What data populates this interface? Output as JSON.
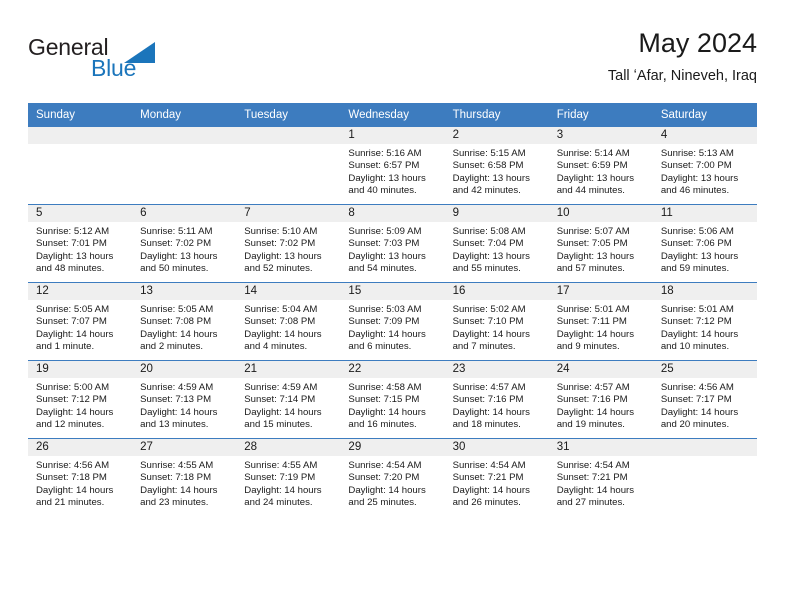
{
  "logo": {
    "word_one": "General",
    "word_two": "Blue",
    "triangle_color": "#1b75bb",
    "icon": "general-blue-logo"
  },
  "header": {
    "title": "May 2024",
    "subtitle": "Tall ʻAfar, Nineveh, Iraq"
  },
  "theme": {
    "header_blue": "#3d7cbf",
    "daynum_band": "#efefef",
    "text": "#1a1a1a",
    "logo_blue": "#1b75bb"
  },
  "weekdays": [
    "Sunday",
    "Monday",
    "Tuesday",
    "Wednesday",
    "Thursday",
    "Friday",
    "Saturday"
  ],
  "labels": {
    "sunrise_prefix": "Sunrise:",
    "sunset_prefix": "Sunset:",
    "daylight_prefix": "Daylight:"
  },
  "weeks": [
    [
      {
        "day": "",
        "sunrise": "",
        "sunset": "",
        "daylight_line1": "",
        "daylight_line2": ""
      },
      {
        "day": "",
        "sunrise": "",
        "sunset": "",
        "daylight_line1": "",
        "daylight_line2": ""
      },
      {
        "day": "",
        "sunrise": "",
        "sunset": "",
        "daylight_line1": "",
        "daylight_line2": ""
      },
      {
        "day": "1",
        "sunrise": "Sunrise: 5:16 AM",
        "sunset": "Sunset: 6:57 PM",
        "daylight_line1": "Daylight: 13 hours",
        "daylight_line2": "and 40 minutes."
      },
      {
        "day": "2",
        "sunrise": "Sunrise: 5:15 AM",
        "sunset": "Sunset: 6:58 PM",
        "daylight_line1": "Daylight: 13 hours",
        "daylight_line2": "and 42 minutes."
      },
      {
        "day": "3",
        "sunrise": "Sunrise: 5:14 AM",
        "sunset": "Sunset: 6:59 PM",
        "daylight_line1": "Daylight: 13 hours",
        "daylight_line2": "and 44 minutes."
      },
      {
        "day": "4",
        "sunrise": "Sunrise: 5:13 AM",
        "sunset": "Sunset: 7:00 PM",
        "daylight_line1": "Daylight: 13 hours",
        "daylight_line2": "and 46 minutes."
      }
    ],
    [
      {
        "day": "5",
        "sunrise": "Sunrise: 5:12 AM",
        "sunset": "Sunset: 7:01 PM",
        "daylight_line1": "Daylight: 13 hours",
        "daylight_line2": "and 48 minutes."
      },
      {
        "day": "6",
        "sunrise": "Sunrise: 5:11 AM",
        "sunset": "Sunset: 7:02 PM",
        "daylight_line1": "Daylight: 13 hours",
        "daylight_line2": "and 50 minutes."
      },
      {
        "day": "7",
        "sunrise": "Sunrise: 5:10 AM",
        "sunset": "Sunset: 7:02 PM",
        "daylight_line1": "Daylight: 13 hours",
        "daylight_line2": "and 52 minutes."
      },
      {
        "day": "8",
        "sunrise": "Sunrise: 5:09 AM",
        "sunset": "Sunset: 7:03 PM",
        "daylight_line1": "Daylight: 13 hours",
        "daylight_line2": "and 54 minutes."
      },
      {
        "day": "9",
        "sunrise": "Sunrise: 5:08 AM",
        "sunset": "Sunset: 7:04 PM",
        "daylight_line1": "Daylight: 13 hours",
        "daylight_line2": "and 55 minutes."
      },
      {
        "day": "10",
        "sunrise": "Sunrise: 5:07 AM",
        "sunset": "Sunset: 7:05 PM",
        "daylight_line1": "Daylight: 13 hours",
        "daylight_line2": "and 57 minutes."
      },
      {
        "day": "11",
        "sunrise": "Sunrise: 5:06 AM",
        "sunset": "Sunset: 7:06 PM",
        "daylight_line1": "Daylight: 13 hours",
        "daylight_line2": "and 59 minutes."
      }
    ],
    [
      {
        "day": "12",
        "sunrise": "Sunrise: 5:05 AM",
        "sunset": "Sunset: 7:07 PM",
        "daylight_line1": "Daylight: 14 hours",
        "daylight_line2": "and 1 minute."
      },
      {
        "day": "13",
        "sunrise": "Sunrise: 5:05 AM",
        "sunset": "Sunset: 7:08 PM",
        "daylight_line1": "Daylight: 14 hours",
        "daylight_line2": "and 2 minutes."
      },
      {
        "day": "14",
        "sunrise": "Sunrise: 5:04 AM",
        "sunset": "Sunset: 7:08 PM",
        "daylight_line1": "Daylight: 14 hours",
        "daylight_line2": "and 4 minutes."
      },
      {
        "day": "15",
        "sunrise": "Sunrise: 5:03 AM",
        "sunset": "Sunset: 7:09 PM",
        "daylight_line1": "Daylight: 14 hours",
        "daylight_line2": "and 6 minutes."
      },
      {
        "day": "16",
        "sunrise": "Sunrise: 5:02 AM",
        "sunset": "Sunset: 7:10 PM",
        "daylight_line1": "Daylight: 14 hours",
        "daylight_line2": "and 7 minutes."
      },
      {
        "day": "17",
        "sunrise": "Sunrise: 5:01 AM",
        "sunset": "Sunset: 7:11 PM",
        "daylight_line1": "Daylight: 14 hours",
        "daylight_line2": "and 9 minutes."
      },
      {
        "day": "18",
        "sunrise": "Sunrise: 5:01 AM",
        "sunset": "Sunset: 7:12 PM",
        "daylight_line1": "Daylight: 14 hours",
        "daylight_line2": "and 10 minutes."
      }
    ],
    [
      {
        "day": "19",
        "sunrise": "Sunrise: 5:00 AM",
        "sunset": "Sunset: 7:12 PM",
        "daylight_line1": "Daylight: 14 hours",
        "daylight_line2": "and 12 minutes."
      },
      {
        "day": "20",
        "sunrise": "Sunrise: 4:59 AM",
        "sunset": "Sunset: 7:13 PM",
        "daylight_line1": "Daylight: 14 hours",
        "daylight_line2": "and 13 minutes."
      },
      {
        "day": "21",
        "sunrise": "Sunrise: 4:59 AM",
        "sunset": "Sunset: 7:14 PM",
        "daylight_line1": "Daylight: 14 hours",
        "daylight_line2": "and 15 minutes."
      },
      {
        "day": "22",
        "sunrise": "Sunrise: 4:58 AM",
        "sunset": "Sunset: 7:15 PM",
        "daylight_line1": "Daylight: 14 hours",
        "daylight_line2": "and 16 minutes."
      },
      {
        "day": "23",
        "sunrise": "Sunrise: 4:57 AM",
        "sunset": "Sunset: 7:16 PM",
        "daylight_line1": "Daylight: 14 hours",
        "daylight_line2": "and 18 minutes."
      },
      {
        "day": "24",
        "sunrise": "Sunrise: 4:57 AM",
        "sunset": "Sunset: 7:16 PM",
        "daylight_line1": "Daylight: 14 hours",
        "daylight_line2": "and 19 minutes."
      },
      {
        "day": "25",
        "sunrise": "Sunrise: 4:56 AM",
        "sunset": "Sunset: 7:17 PM",
        "daylight_line1": "Daylight: 14 hours",
        "daylight_line2": "and 20 minutes."
      }
    ],
    [
      {
        "day": "26",
        "sunrise": "Sunrise: 4:56 AM",
        "sunset": "Sunset: 7:18 PM",
        "daylight_line1": "Daylight: 14 hours",
        "daylight_line2": "and 21 minutes."
      },
      {
        "day": "27",
        "sunrise": "Sunrise: 4:55 AM",
        "sunset": "Sunset: 7:18 PM",
        "daylight_line1": "Daylight: 14 hours",
        "daylight_line2": "and 23 minutes."
      },
      {
        "day": "28",
        "sunrise": "Sunrise: 4:55 AM",
        "sunset": "Sunset: 7:19 PM",
        "daylight_line1": "Daylight: 14 hours",
        "daylight_line2": "and 24 minutes."
      },
      {
        "day": "29",
        "sunrise": "Sunrise: 4:54 AM",
        "sunset": "Sunset: 7:20 PM",
        "daylight_line1": "Daylight: 14 hours",
        "daylight_line2": "and 25 minutes."
      },
      {
        "day": "30",
        "sunrise": "Sunrise: 4:54 AM",
        "sunset": "Sunset: 7:21 PM",
        "daylight_line1": "Daylight: 14 hours",
        "daylight_line2": "and 26 minutes."
      },
      {
        "day": "31",
        "sunrise": "Sunrise: 4:54 AM",
        "sunset": "Sunset: 7:21 PM",
        "daylight_line1": "Daylight: 14 hours",
        "daylight_line2": "and 27 minutes."
      },
      {
        "day": "",
        "sunrise": "",
        "sunset": "",
        "daylight_line1": "",
        "daylight_line2": ""
      }
    ]
  ]
}
